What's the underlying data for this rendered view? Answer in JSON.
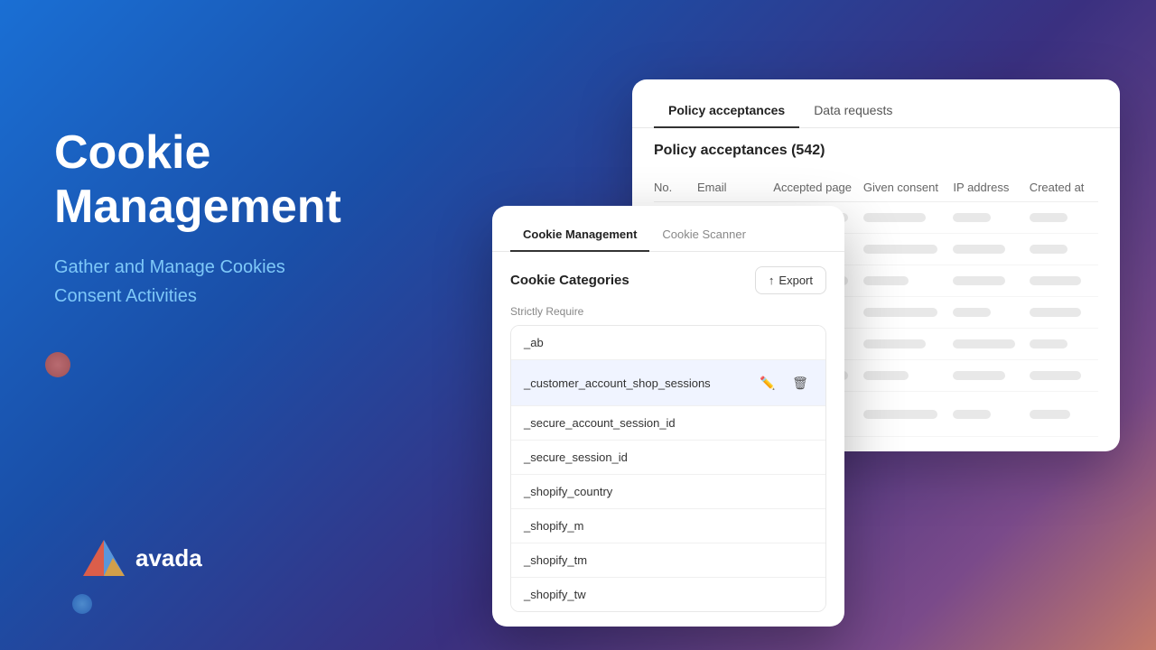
{
  "page": {
    "background": "gradient blue-purple",
    "title": "Cookie Management"
  },
  "hero": {
    "title_line1": "Cookie",
    "title_line2": "Management",
    "subtitle_line1": "Gather and Manage Cookies",
    "subtitle_line2": "Consent Activities"
  },
  "logo": {
    "text": "avada"
  },
  "policy_card": {
    "tabs": [
      {
        "label": "Policy acceptances",
        "active": true
      },
      {
        "label": "Data requests",
        "active": false
      }
    ],
    "title": "Policy acceptances (542)",
    "columns": [
      "No.",
      "Email",
      "Accepted page",
      "Given consent",
      "IP address",
      "Created at"
    ],
    "skeleton_rows": 7
  },
  "cookie_card": {
    "tabs": [
      {
        "label": "Cookie Management",
        "active": true
      },
      {
        "label": "Cookie Scanner",
        "active": false
      }
    ],
    "categories_title": "Cookie Categories",
    "export_label": "Export",
    "section_label": "Strictly Require",
    "cookies": [
      {
        "name": "_ab",
        "highlighted": false
      },
      {
        "name": "_customer_account_shop_sessions",
        "highlighted": true
      },
      {
        "name": "_secure_account_session_id",
        "highlighted": false
      },
      {
        "name": "_secure_session_id",
        "highlighted": false
      },
      {
        "name": "_shopify_country",
        "highlighted": false
      },
      {
        "name": "_shopify_m",
        "highlighted": false
      },
      {
        "name": "_shopify_tm",
        "highlighted": false
      },
      {
        "name": "_shopify_tw",
        "highlighted": false
      }
    ]
  }
}
